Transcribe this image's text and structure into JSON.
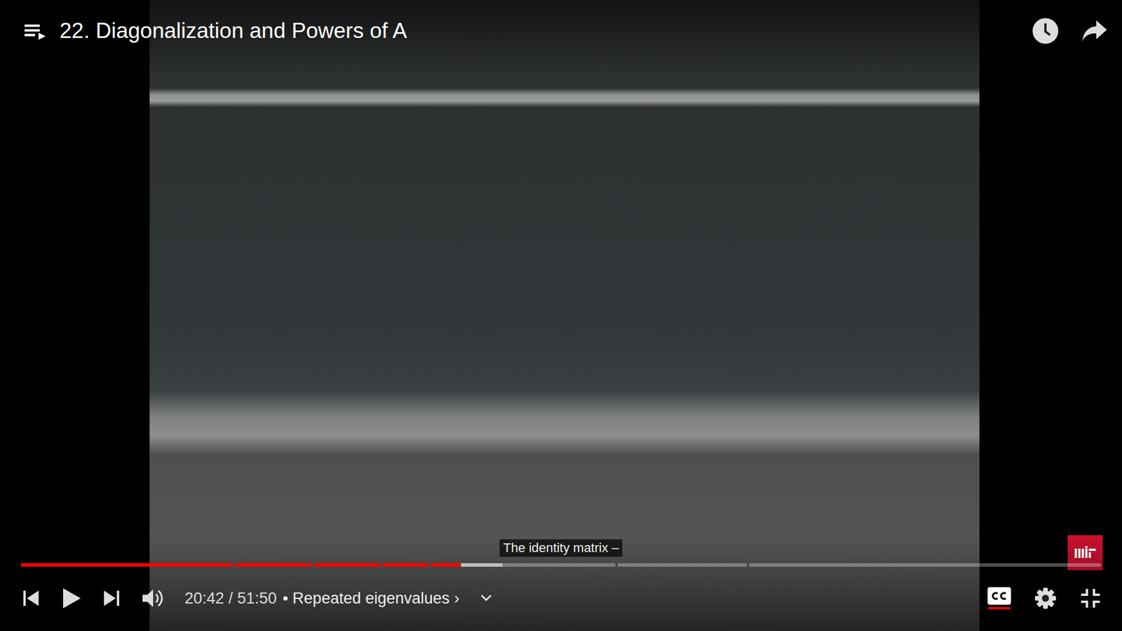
{
  "player": {
    "title": "22. Diagonalization and Powers of A",
    "caption": "The identity matrix –",
    "time": "20:42 / 51:50",
    "chapter": "• Repeated eigenvalues",
    "chapter_arrow": "›",
    "playing": false,
    "captions_on": true,
    "progress": {
      "level": 0.404,
      "buffered": 0.443,
      "chapter_marks": [
        0.199,
        0.271,
        0.333,
        0.376,
        0.549,
        0.67
      ]
    }
  }
}
